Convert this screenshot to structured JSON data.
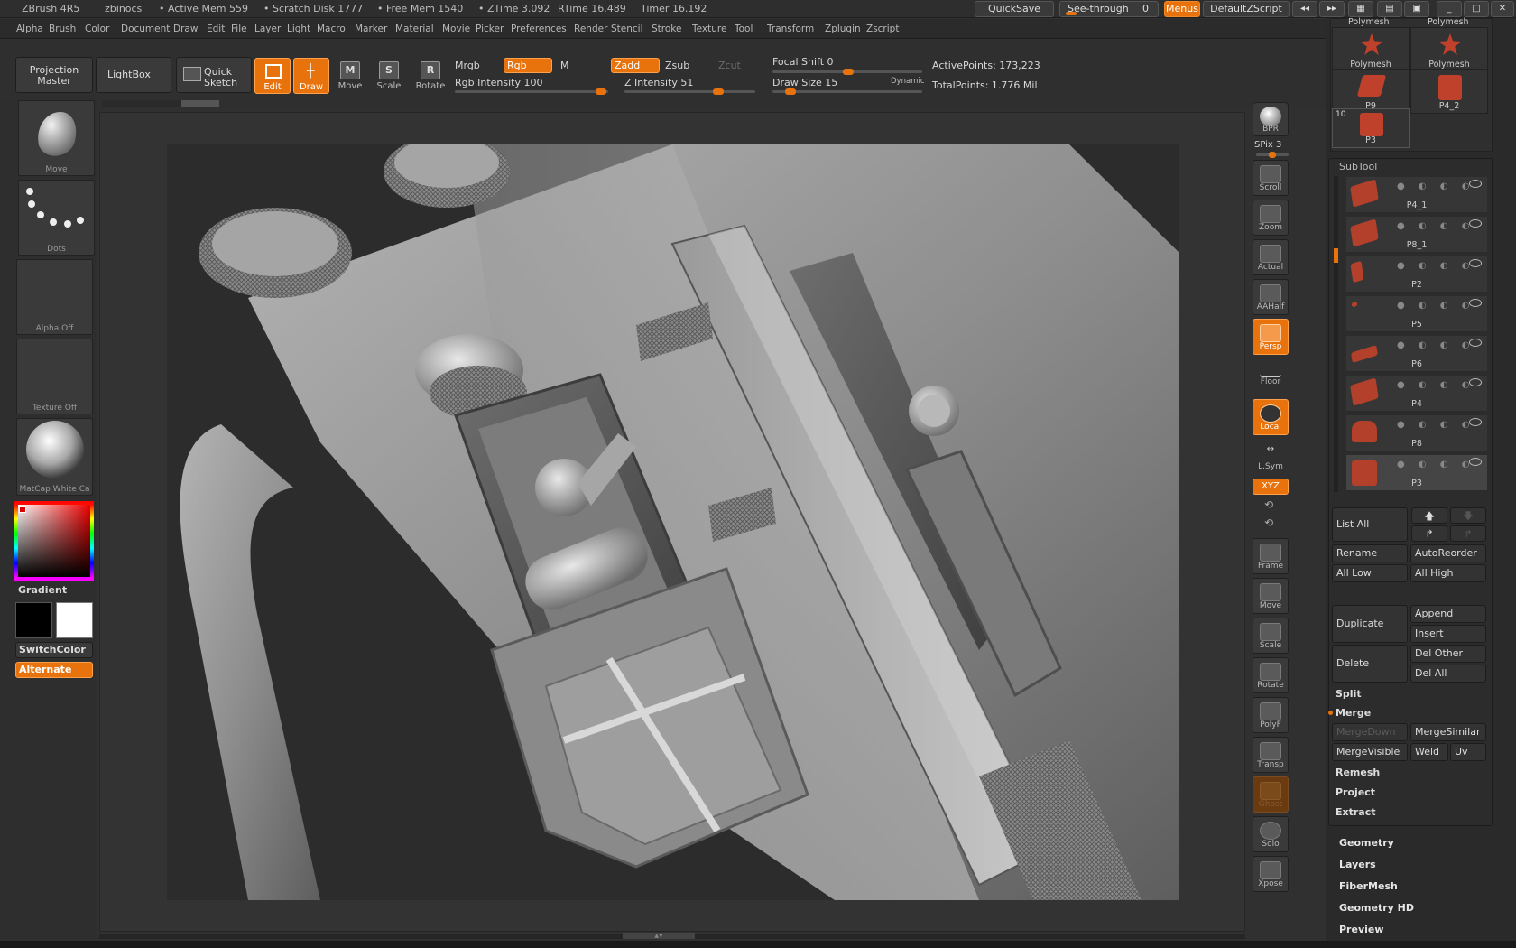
{
  "titlebar": {
    "app": "ZBrush 4R5",
    "doc": "zbinocs",
    "active_mem": "• Active Mem 559",
    "scratch": "• Scratch Disk 1777",
    "free_mem": "• Free Mem 1540",
    "ztime": "• ZTime 3.092",
    "rtime": "RTime 16.489",
    "timer": "Timer 16.192",
    "quicksave": "QuickSave",
    "see_through": "See-through",
    "see_through_value": "0",
    "menus": "Menus",
    "default_zscript": "DefaultZScript"
  },
  "menu": [
    "Alpha",
    "Brush",
    "Color",
    "Document",
    "Draw",
    "Edit",
    "File",
    "Layer",
    "Light",
    "Macro",
    "Marker",
    "Material",
    "Movie",
    "Picker",
    "Preferences",
    "Render",
    "Stencil",
    "Stroke",
    "Texture",
    "Tool",
    "Transform",
    "Zplugin",
    "Zscript"
  ],
  "shelf": {
    "projection_master": "Projection Master",
    "lightbox": "LightBox",
    "quick_sketch": "Quick Sketch",
    "edit": "Edit",
    "draw": "Draw",
    "move": "Move",
    "scale": "Scale",
    "rotate": "Rotate",
    "mrgb": "Mrgb",
    "rgb": "Rgb",
    "m": "M",
    "zadd": "Zadd",
    "zsub": "Zsub",
    "zcut": "Zcut",
    "rgb_intensity": "Rgb Intensity 100",
    "z_intensity": "Z Intensity 51",
    "focal_shift": "Focal Shift 0",
    "draw_size": "Draw Size 15",
    "dynamic": "Dynamic",
    "active_points": "ActivePoints: 173,223",
    "total_points": "TotalPoints: 1.776 Mil"
  },
  "left": {
    "brush": "Move",
    "stroke": "Dots",
    "alpha": "Alpha Off",
    "texture": "Texture Off",
    "material": "MatCap White Ca",
    "gradient": "Gradient",
    "switch_color": "SwitchColor",
    "alternate": "Alternate",
    "primary_color": "#000000",
    "secondary_color": "#ffffff"
  },
  "right_strip": {
    "bpr": "BPR",
    "spix": "SPix 3",
    "scroll": "Scroll",
    "zoom": "Zoom",
    "actual": "Actual",
    "aahalf": "AAHalf",
    "persp": "Persp",
    "floor": "Floor",
    "local": "Local",
    "lsym": "L.Sym",
    "xyz": "XYZ",
    "frame": "Frame",
    "move": "Move",
    "scale": "Scale",
    "rotate": "Rotate",
    "polyf": "PolyF",
    "transp": "Transp",
    "ghost": "Ghost",
    "solo": "Solo",
    "xpose": "Xpose"
  },
  "tools": [
    {
      "name": "Polymesh"
    },
    {
      "name": "Polymesh"
    },
    {
      "name": "P9"
    },
    {
      "name": "P4_2"
    },
    {
      "name": "P3",
      "count": "10"
    }
  ],
  "tools_top": [
    "Polymesh",
    "Polymesh"
  ],
  "subtool": {
    "title": "SubTool",
    "items": [
      "P4_1",
      "P8_1",
      "P2",
      "P5",
      "P6",
      "P4",
      "P8",
      "P3"
    ],
    "list_all": "List All",
    "rename": "Rename",
    "autoreorder": "AutoReorder",
    "all_low": "All Low",
    "all_high": "All High",
    "duplicate": "Duplicate",
    "append": "Append",
    "insert": "Insert",
    "delete": "Delete",
    "del_other": "Del Other",
    "del_all": "Del All",
    "split": "Split",
    "merge": "Merge",
    "mergedown": "MergeDown",
    "mergesimilar": "MergeSimilar",
    "mergevisible": "MergeVisible",
    "weld": "Weld",
    "uv": "Uv",
    "remesh": "Remesh",
    "project": "Project",
    "extract": "Extract"
  },
  "sections": [
    "Geometry",
    "Layers",
    "FiberMesh",
    "Geometry HD",
    "Preview"
  ],
  "colors": {
    "accent": "#e8730c",
    "subtool_thumb": "#b3402a"
  }
}
